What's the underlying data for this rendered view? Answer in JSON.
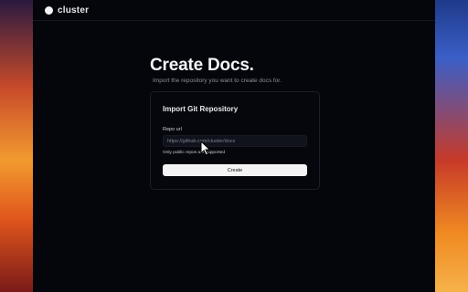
{
  "app": {
    "brand": "cluster"
  },
  "page": {
    "title": "Create Docs.",
    "subtitle": "Import the repository you want to create docs for."
  },
  "form": {
    "heading": "Import Git Repository",
    "repo_label": "Repo url",
    "repo_placeholder": "https://github.com/cluster/docs",
    "hint": "Only public repos are supported",
    "submit_label": "Create"
  },
  "icons": {
    "cursor": "mouse-pointer-icon",
    "logo": "logo-circle-icon"
  },
  "colors": {
    "window_bg": "#04060b",
    "button_bg": "#f4f4f5",
    "text_primary": "#f4f4f6",
    "text_muted": "#8a8f9a"
  }
}
